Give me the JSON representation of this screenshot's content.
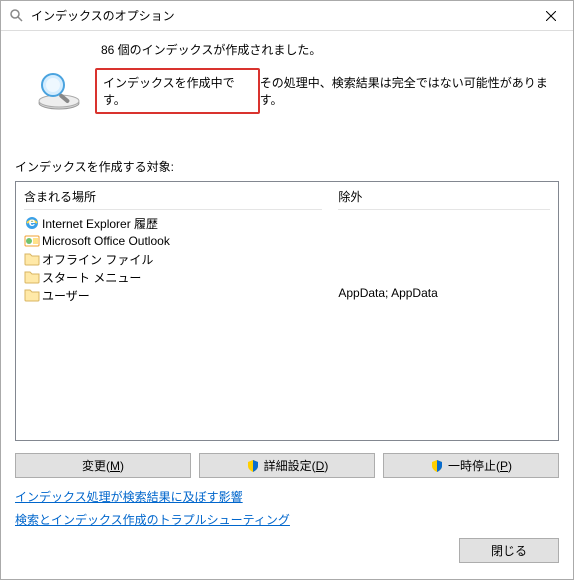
{
  "window": {
    "title": "インデックスのオプション"
  },
  "header": {
    "count_text": "86 個のインデックスが作成されました。",
    "building_text": "インデックスを作成中です。",
    "status_rest": "その処理中、検索結果は完全ではない可能性があります。"
  },
  "targets_label": "インデックスを作成する対象:",
  "columns": {
    "included": "含まれる場所",
    "excluded": "除外"
  },
  "locations": [
    {
      "icon": "ie",
      "name": "Internet Explorer 履歴"
    },
    {
      "icon": "outlook",
      "name": "Microsoft Office Outlook"
    },
    {
      "icon": "folder",
      "name": "オフライン ファイル"
    },
    {
      "icon": "folder",
      "name": "スタート メニュー"
    },
    {
      "icon": "folder",
      "name": "ユーザー"
    }
  ],
  "exclusions": "AppData; AppData",
  "buttons": {
    "modify": "変更(M)",
    "advanced": "詳細設定(D)",
    "pause": "一時停止(P)"
  },
  "links": {
    "effect": "インデックス処理が検索結果に及ぼす影響",
    "troubleshoot": "検索とインデックス作成のトラプルシューティング"
  },
  "close": "閉じる"
}
